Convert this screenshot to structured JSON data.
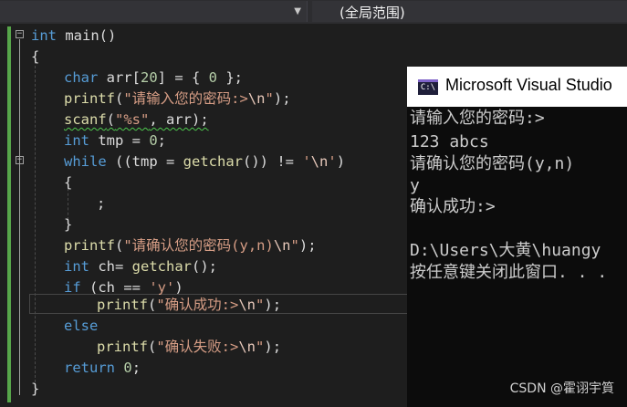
{
  "nav": {
    "left_dropdown_icon": "chevron-down-icon",
    "scope_label": "(全局范围)"
  },
  "code": {
    "l1": {
      "kw": "int",
      "rest": " main()"
    },
    "l2": "{",
    "l3": {
      "kw": "char",
      "pre": " arr[",
      "num1": "20",
      "mid": "] = { ",
      "num2": "0",
      "post": " };"
    },
    "l4": {
      "fn": "printf",
      "p1": "(",
      "str": "\"请输入您的密码:>",
      "esc": "\\n",
      "str2": "\"",
      "p2": ");"
    },
    "l5": {
      "fn": "scanf",
      "p1": "(",
      "str": "\"%s\"",
      "rest": ", arr);"
    },
    "l6": {
      "kw": "int",
      "pre": " tmp = ",
      "num": "0",
      "post": ";"
    },
    "l7": {
      "kw": "while",
      "pre": " ((tmp = ",
      "fn": "getchar",
      "mid": "()) != ",
      "str": "'",
      "esc": "\\n",
      "str2": "'",
      "post": ")"
    },
    "l8": "{",
    "l9": ";",
    "l10": "}",
    "l11": {
      "fn": "printf",
      "p1": "(",
      "str": "\"请确认您的密码(y,n)",
      "esc": "\\n",
      "str2": "\"",
      "p2": ");"
    },
    "l12": {
      "kw": "int",
      "pre": " ch= ",
      "fn": "getchar",
      "post": "();"
    },
    "l13": {
      "kw": "if",
      "pre": " (ch == ",
      "str": "'y'",
      "post": ")"
    },
    "l14": {
      "fn": "printf",
      "p1": "(",
      "str": "\"确认成功:>",
      "esc": "\\n",
      "str2": "\"",
      "p2": ");"
    },
    "l15": {
      "kw": "else"
    },
    "l16": {
      "fn": "printf",
      "p1": "(",
      "str": "\"确认失败:>",
      "esc": "\\n",
      "str2": "\"",
      "p2": ");"
    },
    "l17": {
      "kw": "return",
      "pre": " ",
      "num": "0",
      "post": ";"
    },
    "l18": "}",
    "fold_minus": "−"
  },
  "console": {
    "icon_text": "C:\\",
    "title": "Microsoft Visual Studio",
    "lines": [
      "请输入您的密码:>",
      "123 abcs",
      "请确认您的密码(y,n)",
      "y",
      "确认成功:>",
      "",
      "D:\\Users\\大黄\\huangy",
      "按任意键关闭此窗口. . ."
    ]
  },
  "watermark": "CSDN @霍诩宇筫",
  "colors": {
    "keyword": "#569cd6",
    "function": "#dcdcaa",
    "string": "#d69d85",
    "number": "#b5cea8",
    "change_bar": "#57a64a"
  }
}
